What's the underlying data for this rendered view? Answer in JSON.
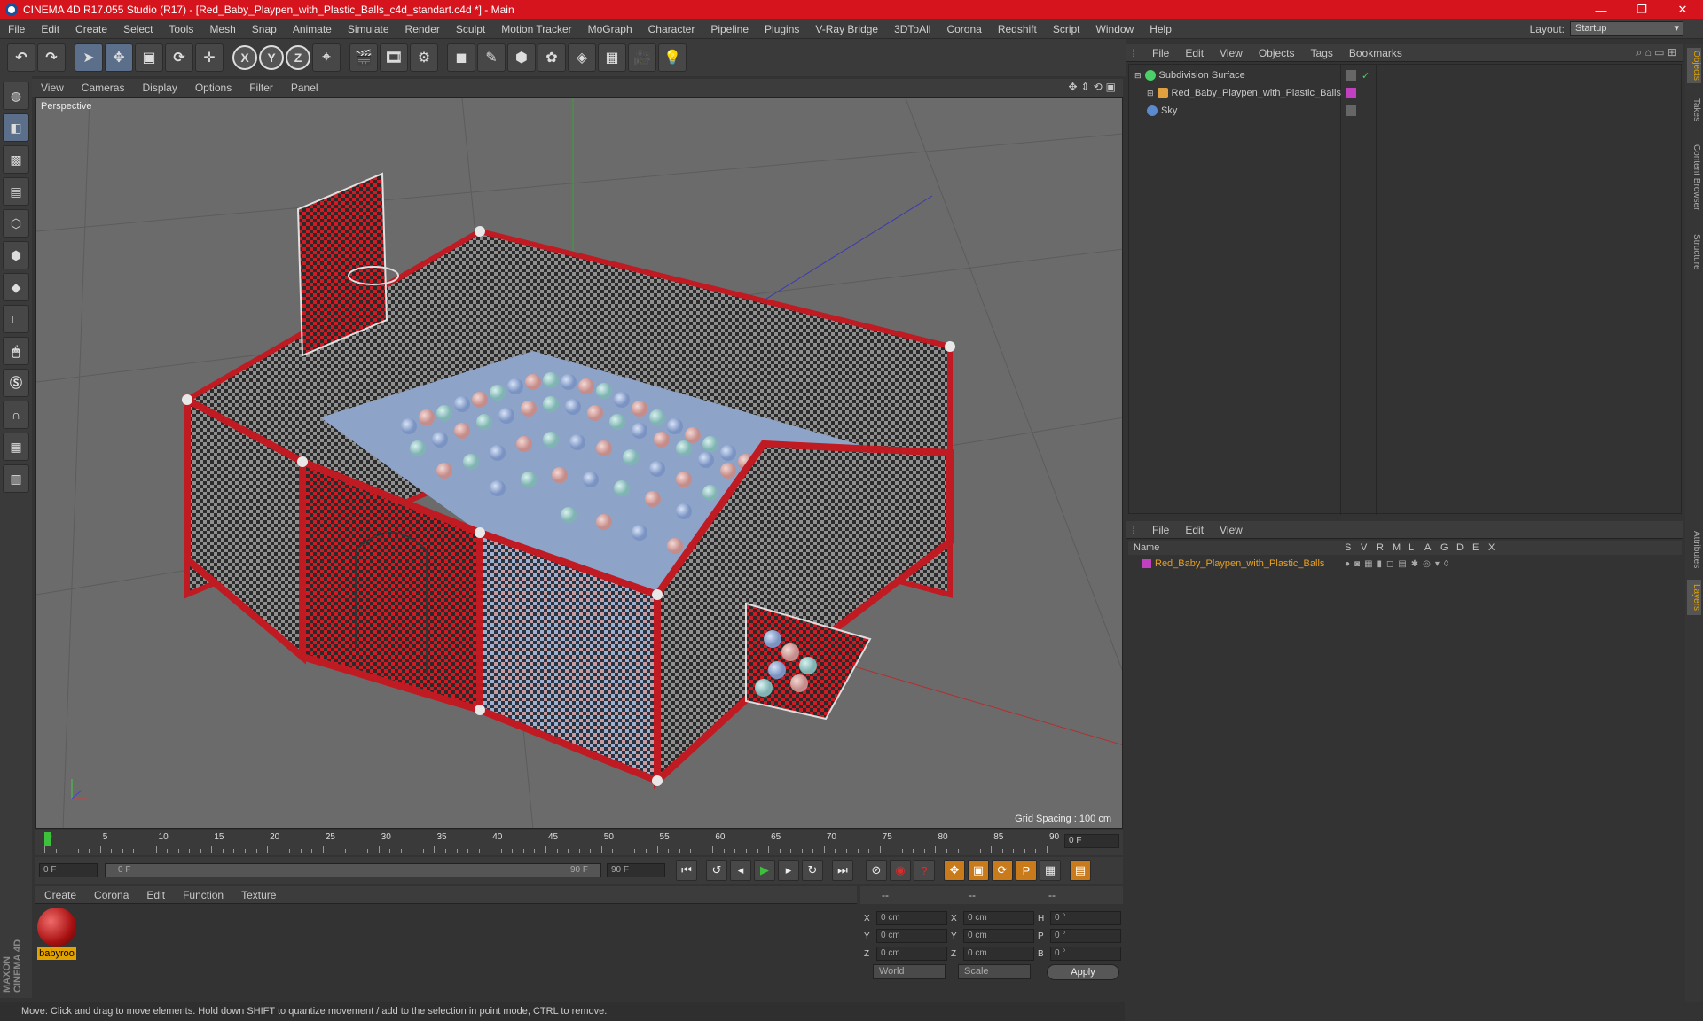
{
  "window": {
    "title": "CINEMA 4D R17.055 Studio (R17) - [Red_Baby_Playpen_with_Plastic_Balls_c4d_standart.c4d *] - Main",
    "controls": [
      "—",
      "❐",
      "✕"
    ]
  },
  "menu": [
    "File",
    "Edit",
    "Create",
    "Select",
    "Tools",
    "Mesh",
    "Snap",
    "Animate",
    "Simulate",
    "Render",
    "Sculpt",
    "Motion Tracker",
    "MoGraph",
    "Character",
    "Pipeline",
    "Plugins",
    "V-Ray Bridge",
    "3DToAll",
    "Corona",
    "Redshift",
    "Script",
    "Window",
    "Help"
  ],
  "layout": {
    "label": "Layout:",
    "value": "Startup"
  },
  "viewport": {
    "menu": [
      "View",
      "Cameras",
      "Display",
      "Options",
      "Filter",
      "Panel"
    ],
    "label": "Perspective",
    "grid_spacing": "Grid Spacing : 100 cm"
  },
  "timeline": {
    "ticks": [
      "0",
      "5",
      "10",
      "15",
      "20",
      "25",
      "30",
      "35",
      "40",
      "45",
      "50",
      "55",
      "60",
      "65",
      "70",
      "75",
      "80",
      "85",
      "90"
    ],
    "current_frame": "0 F",
    "start": "0 F",
    "slider_start": "0 F",
    "slider_end": "90 F",
    "end": "90 F"
  },
  "material_manager": {
    "menu": [
      "Create",
      "Corona",
      "Edit",
      "Function",
      "Texture"
    ],
    "materials": [
      {
        "name": "babyroo",
        "color": "#c41a1a"
      }
    ]
  },
  "coordinates": {
    "headers": [
      "--",
      "--",
      "--"
    ],
    "rows": [
      {
        "a1": "X",
        "v1": "0 cm",
        "a2": "X",
        "v2": "0 cm",
        "a3": "H",
        "v3": "0 °"
      },
      {
        "a1": "Y",
        "v1": "0 cm",
        "a2": "Y",
        "v2": "0 cm",
        "a3": "P",
        "v3": "0 °"
      },
      {
        "a1": "Z",
        "v1": "0 cm",
        "a2": "Z",
        "v2": "0 cm",
        "a3": "B",
        "v3": "0 °"
      }
    ],
    "mode1": "World",
    "mode2": "Scale",
    "apply": "Apply"
  },
  "status": "Move: Click and drag to move elements. Hold down SHIFT to quantize movement / add to the selection in point mode, CTRL to remove.",
  "objects_panel": {
    "menu": [
      "File",
      "Edit",
      "View",
      "Objects",
      "Tags",
      "Bookmarks"
    ],
    "items": [
      {
        "name": "Subdivision Surface",
        "icon_color": "#4ccf6a",
        "tag": "✓"
      },
      {
        "name": "Red_Baby_Playpen_with_Plastic_Balls",
        "icon_color": "#e0a040",
        "tag": ""
      },
      {
        "name": "Sky",
        "icon_color": "#5a8ad0",
        "tag": ""
      }
    ]
  },
  "layers_panel": {
    "menu": [
      "File",
      "Edit",
      "View"
    ],
    "columns": [
      "Name",
      "S",
      "V",
      "R",
      "M",
      "L",
      "A",
      "G",
      "D",
      "E",
      "X"
    ],
    "items": [
      {
        "name": "Red_Baby_Playpen_with_Plastic_Balls",
        "color": "#c040c0"
      }
    ]
  },
  "right_tabs": [
    "Objects",
    "Takes",
    "Content Browser",
    "Structure",
    "Attributes",
    "Layers"
  ],
  "brand": "MAXON CINEMA 4D",
  "colors": {
    "accent_red": "#d5141e",
    "highlight_orange": "#e2a300",
    "layer_text": "#e8a020"
  }
}
